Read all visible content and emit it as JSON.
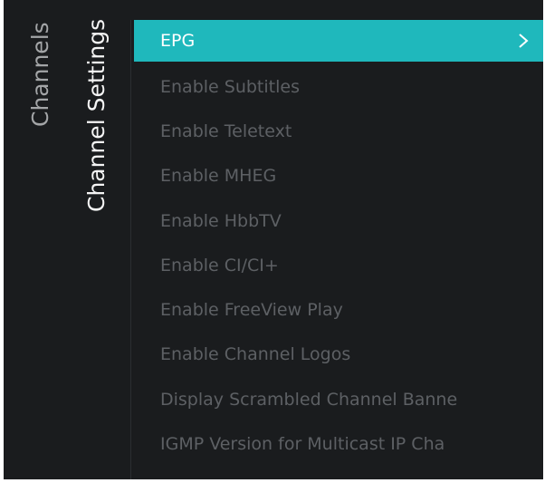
{
  "breadcrumb": {
    "parent_label": "Channels",
    "current_label": "Channel Settings"
  },
  "menu": {
    "items": [
      {
        "label": "EPG",
        "selected": true,
        "icon": "chevron-right-icon"
      },
      {
        "label": "Enable Subtitles",
        "selected": false
      },
      {
        "label": "Enable Teletext",
        "selected": false
      },
      {
        "label": "Enable MHEG",
        "selected": false
      },
      {
        "label": "Enable HbbTV",
        "selected": false
      },
      {
        "label": "Enable CI/CI+",
        "selected": false
      },
      {
        "label": "Enable FreeView Play",
        "selected": false
      },
      {
        "label": "Enable Channel Logos",
        "selected": false
      },
      {
        "label": "Display Scrambled Channel Banne",
        "selected": false
      },
      {
        "label": "IGMP Version for Multicast IP Cha",
        "selected": false
      }
    ]
  },
  "colors": {
    "background": "#1a1c1e",
    "highlight": "#1fb8bc",
    "item_text": "#5d6064",
    "selected_text": "#ffffff",
    "breadcrumb_parent": "#a3a5a7",
    "breadcrumb_current": "#f4f4f4"
  }
}
